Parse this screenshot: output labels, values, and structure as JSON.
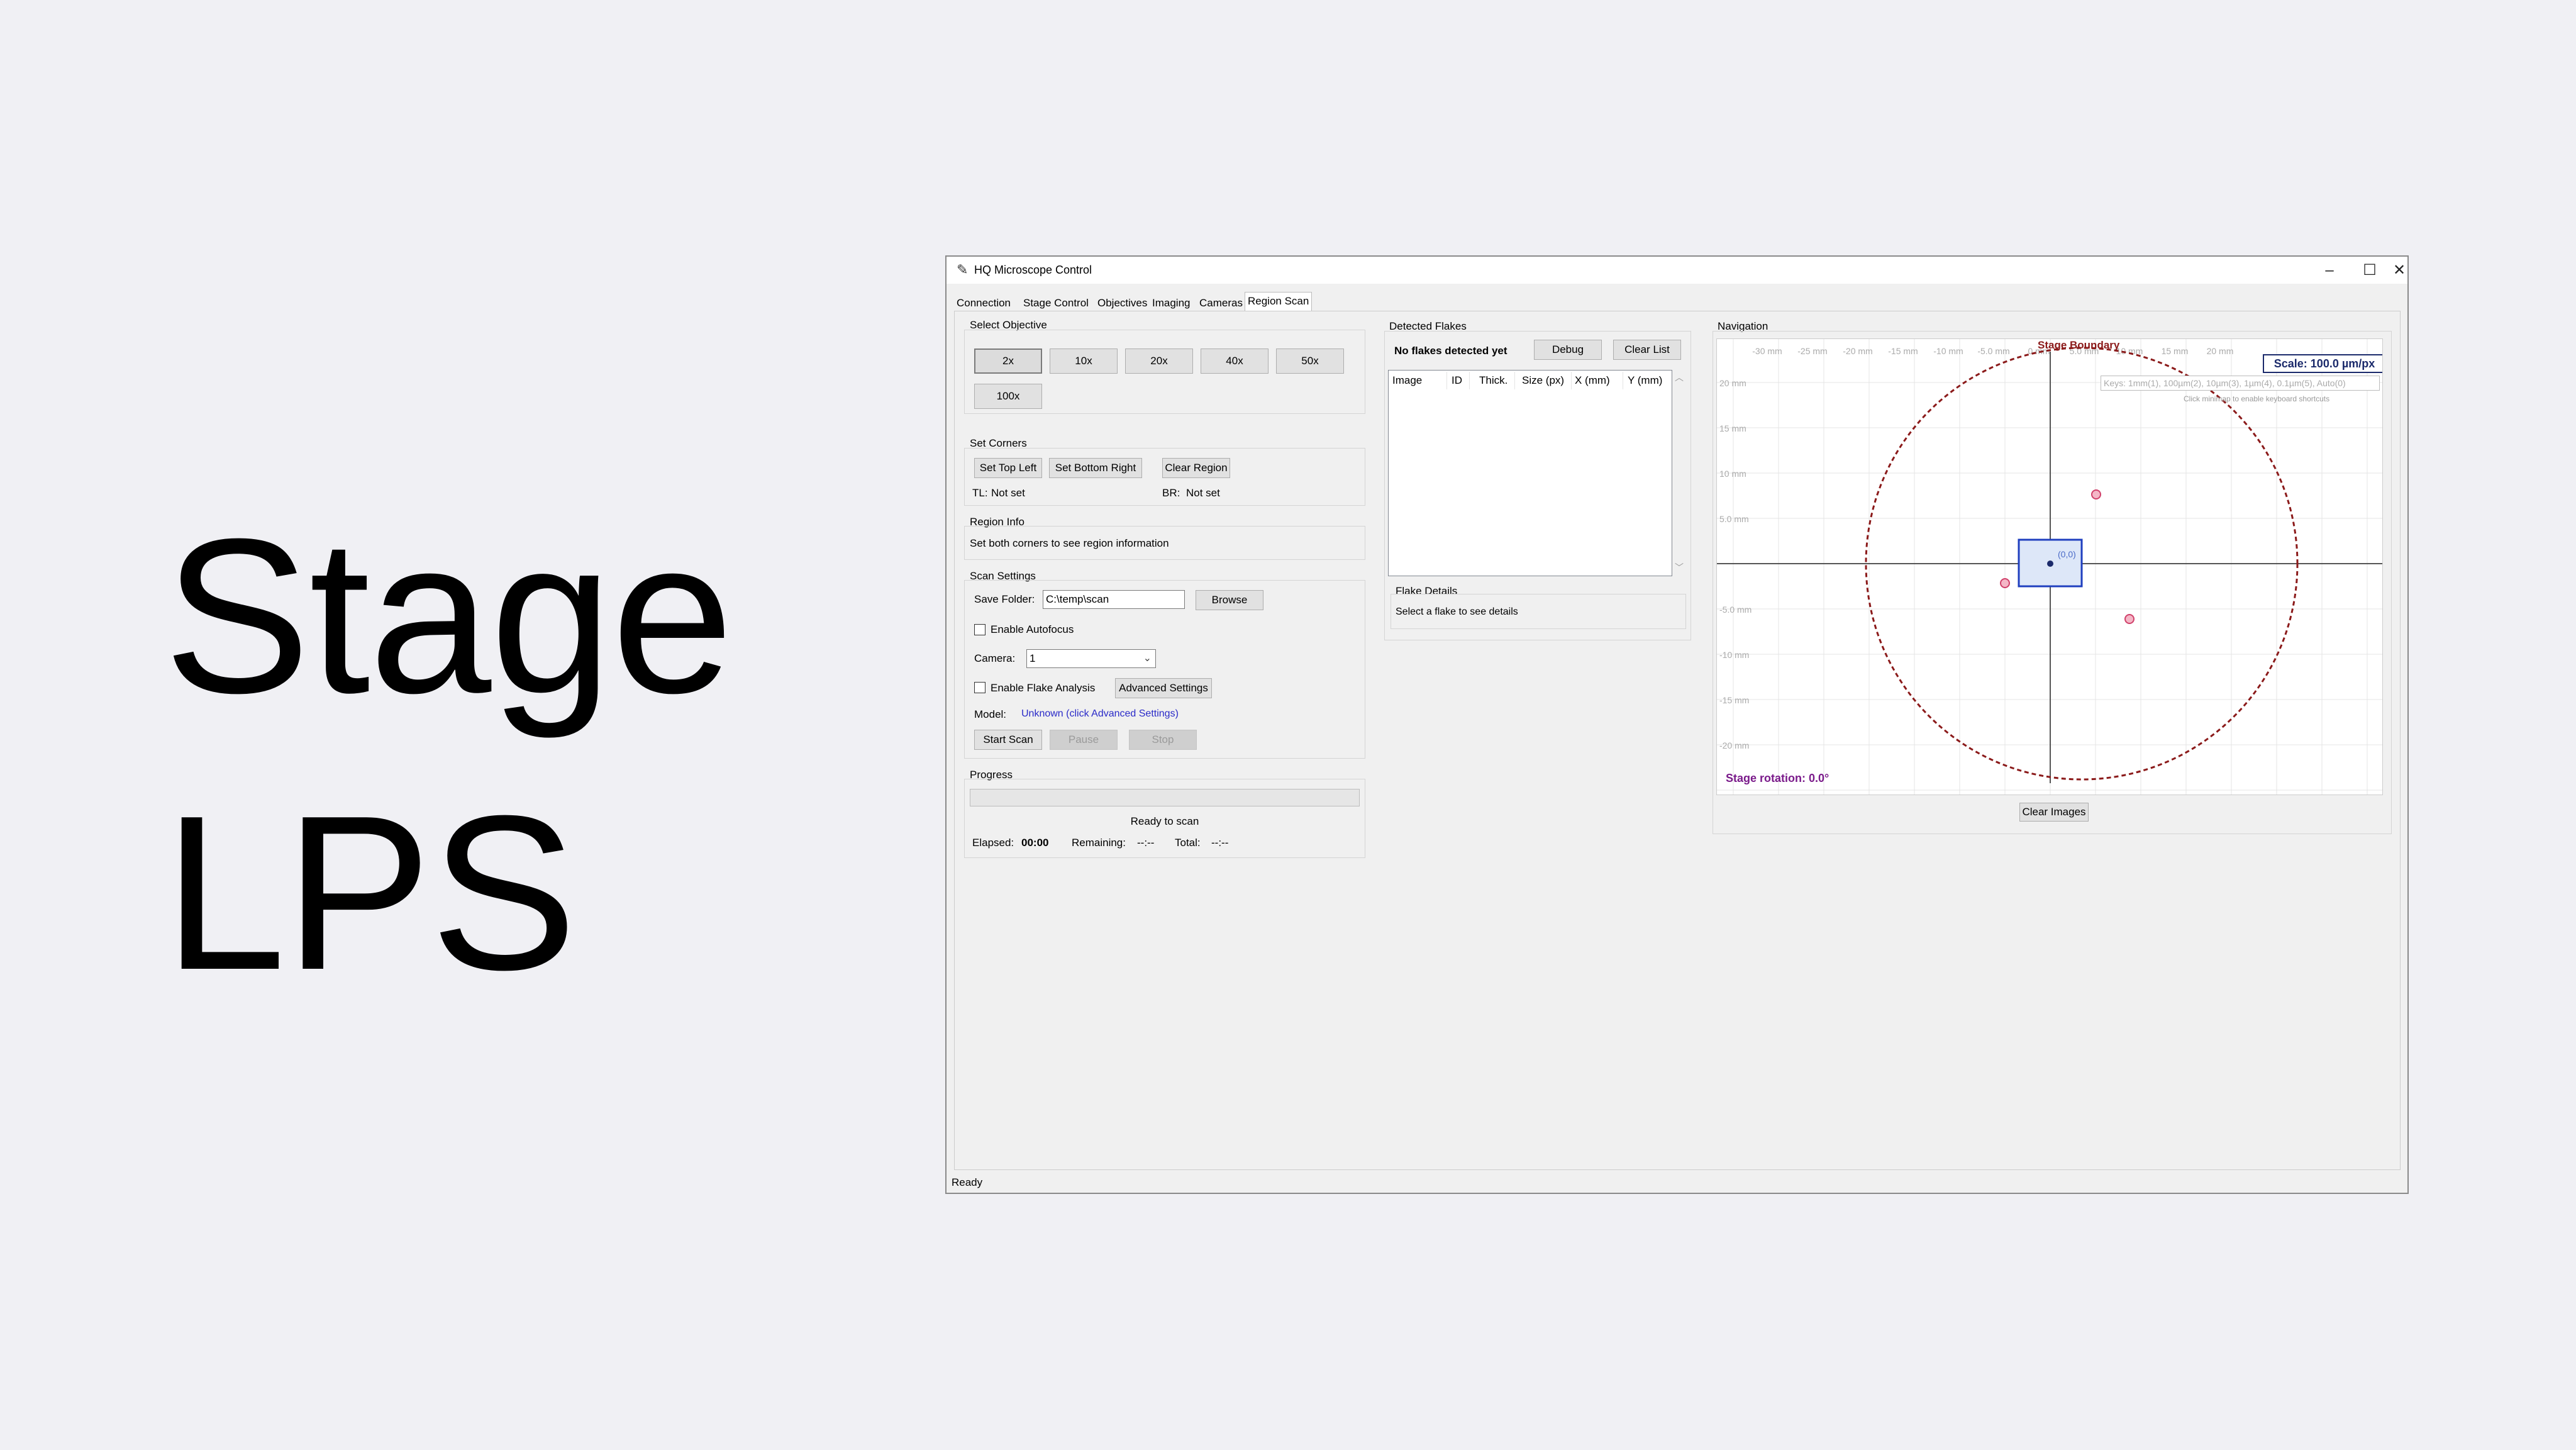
{
  "slide": {
    "line1": "Stage",
    "line2": "LPS"
  },
  "window": {
    "title": "HQ Microscope Control",
    "minimize": "–",
    "maximize": "☐",
    "close": "✕"
  },
  "tabs": [
    "Connection",
    "Stage Control",
    "Objectives",
    "Imaging",
    "Cameras",
    "Region Scan"
  ],
  "select_objective": {
    "title": "Select Objective",
    "buttons": [
      "2x",
      "10x",
      "20x",
      "40x",
      "50x",
      "100x"
    ],
    "selected": "2x"
  },
  "set_corners": {
    "title": "Set Corners",
    "top_left_button": "Set Top Left",
    "bottom_right_button": "Set Bottom Right",
    "clear_button": "Clear Region",
    "tl_label": "TL:",
    "tl_value": "Not set",
    "br_label": "BR:",
    "br_value": "Not set"
  },
  "region_info": {
    "title": "Region Info",
    "text": "Set both corners to see region information"
  },
  "scan_settings": {
    "title": "Scan Settings",
    "save_folder_label": "Save Folder:",
    "save_folder_value": "C:\\temp\\scan",
    "browse_button": "Browse",
    "autofocus_label": "Enable Autofocus",
    "camera_label": "Camera:",
    "camera_value": "1",
    "flake_analysis_label": "Enable Flake Analysis",
    "advanced_button": "Advanced Settings",
    "model_label": "Model:",
    "model_value": "Unknown (click Advanced Settings)",
    "start_button": "Start Scan",
    "pause_button": "Pause",
    "stop_button": "Stop"
  },
  "progress": {
    "title": "Progress",
    "fraction": 0,
    "status": "Ready to scan",
    "elapsed_label": "Elapsed:",
    "elapsed_value": "00:00",
    "remaining_label": "Remaining:",
    "remaining_value": "--:--",
    "total_label": "Total:",
    "total_value": "--:--"
  },
  "detected_flakes": {
    "title": "Detected Flakes",
    "status": "No flakes detected yet",
    "debug_button": "Debug",
    "clear_button": "Clear List",
    "columns": [
      "Image",
      "ID",
      "Thick.",
      "Size (px)",
      "X (mm)",
      "Y (mm)"
    ]
  },
  "flake_details": {
    "title": "Flake Details",
    "text": "Select a flake to see details"
  },
  "navigation": {
    "title": "Navigation",
    "boundary_label": "Stage Boundary",
    "scale_label": "Scale: 100.0 µm/px",
    "keys_hint": "Keys: 1mm(1), 100µm(2), 10µm(3), 1µm(4), 0.1µm(5), Auto(0)",
    "click_hint": "Click minimap to enable keyboard shortcuts",
    "x_ticks": [
      "-30 mm",
      "-25 mm",
      "-20 mm",
      "-15 mm",
      "-10 mm",
      "-5.0 mm",
      "0 mm",
      "5.0 mm",
      "10 mm",
      "15 mm",
      "20 mm"
    ],
    "y_ticks": [
      "20 mm",
      "15 mm",
      "10 mm",
      "5.0 mm",
      "-5.0 mm",
      "-10 mm",
      "-15 mm",
      "-20 mm"
    ],
    "origin_label": "(0,0)",
    "rotation_label": "Stage rotation: 0.0°",
    "clear_images_button": "Clear Images",
    "colors": {
      "boundary": "#8b1a1a",
      "position_box": "#1f3fbf",
      "markers": "#d0406a",
      "rotation": "#7a1a8a"
    }
  },
  "statusbar": {
    "text": "Ready"
  }
}
